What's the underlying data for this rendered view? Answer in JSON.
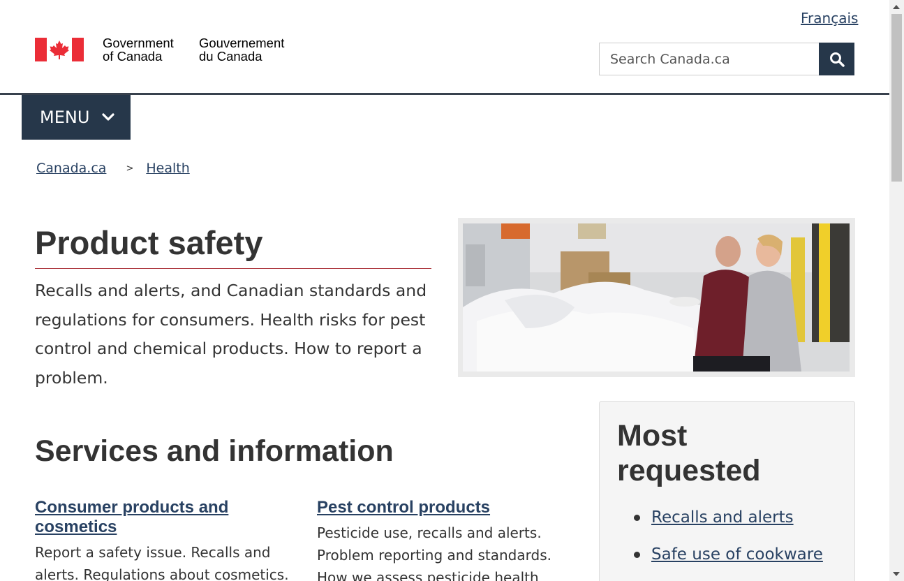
{
  "header": {
    "language_link": "Français",
    "signature_en_line1": "Government",
    "signature_en_line2": "of Canada",
    "signature_fr_line1": "Gouvernement",
    "signature_fr_line2": "du Canada",
    "search_placeholder": "Search Canada.ca",
    "menu_label": "MENU"
  },
  "breadcrumb": [
    {
      "label": "Canada.ca"
    },
    {
      "label": "Health"
    }
  ],
  "breadcrumb_separator": ">",
  "page": {
    "title": "Product safety",
    "lead": "Recalls and alerts, and Canadian standards and regulations for consumers. Health risks for pest control and chemical products. How to report a problem."
  },
  "services": {
    "heading": "Services and information",
    "items": [
      {
        "title": "Consumer products and cosmetics",
        "description": "Report a safety issue. Recalls and alerts. Regulations about cosmetics."
      },
      {
        "title": "Pest control products",
        "description": "Pesticide use, recalls and alerts. Problem reporting and standards. How we assess pesticide health"
      }
    ]
  },
  "most_requested": {
    "heading": "Most requested",
    "items": [
      {
        "label": "Recalls and alerts"
      },
      {
        "label": "Safe use of cookware"
      }
    ]
  },
  "colors": {
    "brand_dark": "#26374a",
    "link": "#284162",
    "flag_red": "#eb2d37",
    "title_underline": "#af3c43"
  }
}
